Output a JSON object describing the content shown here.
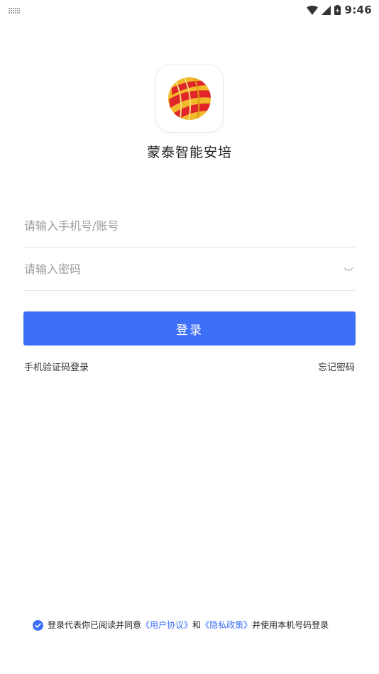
{
  "status_bar": {
    "time": "9:46",
    "icons": [
      "keyboard-icon",
      "wifi-icon",
      "signal-icon",
      "battery-icon"
    ]
  },
  "app": {
    "name": "蒙泰智能安培",
    "logo_icon": "globe-logo-icon"
  },
  "login_form": {
    "phone_placeholder": "请输入手机号/账号",
    "phone_value": "",
    "password_placeholder": "请输入密码",
    "password_value": "",
    "password_toggle_icon": "eye-closed-icon",
    "login_button": "登录"
  },
  "links": {
    "sms_login": "手机验证码登录",
    "forgot_password": "忘记密码"
  },
  "agreement": {
    "checked": true,
    "prefix": "登录代表你已阅读并同意",
    "user_agreement": "《用户协议》",
    "and": "和",
    "privacy_policy": "《隐私政策》",
    "suffix": "并使用本机号码登录"
  },
  "colors": {
    "primary": "#3d6ff8",
    "logo_red": "#e0262b",
    "logo_gold": "#f2b92a"
  }
}
